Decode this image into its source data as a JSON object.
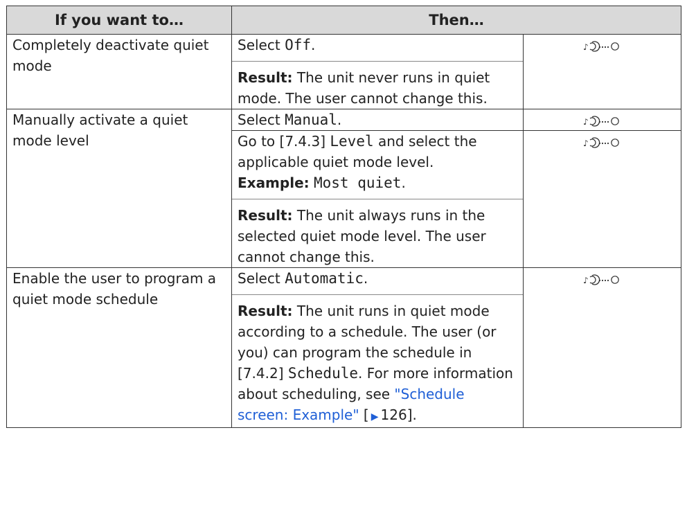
{
  "table": {
    "header_left": "If you want to…",
    "header_right": "Then…"
  },
  "rows": {
    "r1": {
      "want": "Completely deactivate quiet mode",
      "select_prefix": "Select ",
      "select_value": "Off",
      "select_suffix": ".",
      "result_label": "Result:",
      "result_text": " The unit never runs in quiet mode. The user cannot change this."
    },
    "r2": {
      "want": "Manually activate a quiet mode level",
      "select_prefix": "Select ",
      "select_value": "Manual",
      "select_suffix": ".",
      "goto_prefix": "Go to [7.4.3] ",
      "goto_value": "Level",
      "goto_suffix": " and select the applicable quiet mode level.",
      "example_label": "Example:",
      "example_value": "Most quiet",
      "example_suffix": ".",
      "result_label": "Result:",
      "result_text": " The unit always runs in the selected quiet mode level. The user cannot change this."
    },
    "r3": {
      "want": "Enable the user to program a quiet mode schedule",
      "select_prefix": "Select ",
      "select_value": "Automatic",
      "select_suffix": ".",
      "result_label": "Result:",
      "result_text_1": " The unit runs in quiet mode according to a schedule. The user (or you) can program the schedule in [7.4.2] ",
      "result_value": "Schedule",
      "result_text_2": ". For more information about scheduling, see ",
      "link_text": "\"Schedule screen: Example\"",
      "ref_open": " [",
      "page_ref": "126",
      "ref_close": "]."
    }
  },
  "icons": {
    "access_level": "installer-access-level-icon"
  }
}
